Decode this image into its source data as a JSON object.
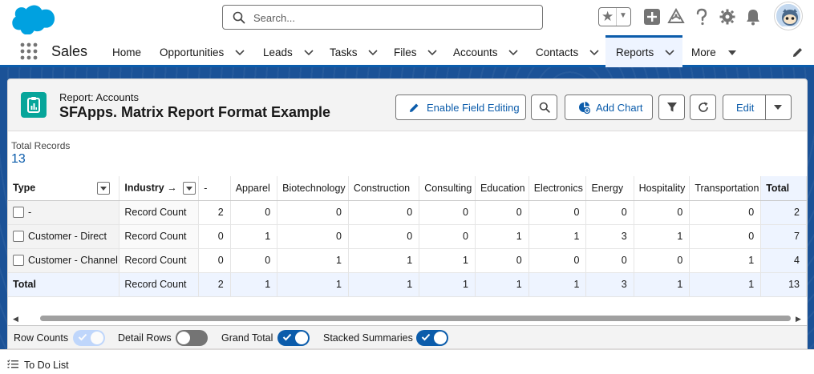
{
  "header": {
    "search_placeholder": "Search...",
    "icons": [
      "salesforce-logo",
      "search-icon",
      "favorites-star-icon",
      "favorites-dropdown-icon",
      "global-actions-icon",
      "trailhead-icon",
      "help-icon",
      "setup-gear-icon",
      "notifications-bell-icon",
      "user-avatar"
    ]
  },
  "nav": {
    "app_name": "Sales",
    "items": [
      {
        "label": "Home",
        "has_menu": false
      },
      {
        "label": "Opportunities",
        "has_menu": true
      },
      {
        "label": "Leads",
        "has_menu": true
      },
      {
        "label": "Tasks",
        "has_menu": true
      },
      {
        "label": "Files",
        "has_menu": true
      },
      {
        "label": "Accounts",
        "has_menu": true
      },
      {
        "label": "Contacts",
        "has_menu": true
      },
      {
        "label": "Reports",
        "has_menu": true,
        "active": true
      },
      {
        "label": "More",
        "has_menu": true
      }
    ]
  },
  "report": {
    "type_label": "Report: Accounts",
    "title": "SFApps. Matrix Report Format Example",
    "buttons": {
      "enable_field_editing": "Enable Field Editing",
      "add_chart": "Add Chart",
      "edit": "Edit"
    },
    "total_records_label": "Total Records",
    "total_records_value": "13"
  },
  "matrix": {
    "row_group_header": "Type",
    "col_group_header": "Industry",
    "col_group_arrow": "→",
    "columns": [
      "-",
      "Apparel",
      "Biotechnology",
      "Construction",
      "Consulting",
      "Education",
      "Electronics",
      "Energy",
      "Hospitality",
      "Transportation",
      "Total"
    ],
    "rows": [
      {
        "label": "-",
        "measure": "Record Count",
        "values": [
          "2",
          "0",
          "0",
          "0",
          "0",
          "0",
          "0",
          "0",
          "0",
          "0",
          "2"
        ]
      },
      {
        "label": "Customer - Direct",
        "measure": "Record Count",
        "values": [
          "0",
          "1",
          "0",
          "0",
          "0",
          "1",
          "1",
          "3",
          "1",
          "0",
          "7"
        ]
      },
      {
        "label": "Customer - Channel",
        "measure": "Record Count",
        "values": [
          "0",
          "0",
          "1",
          "1",
          "1",
          "0",
          "0",
          "0",
          "0",
          "1",
          "4"
        ]
      }
    ],
    "total_row": {
      "label": "Total",
      "measure": "Record Count",
      "values": [
        "2",
        "1",
        "1",
        "1",
        "1",
        "1",
        "1",
        "3",
        "1",
        "1",
        "13"
      ]
    }
  },
  "footer": {
    "toggles": [
      {
        "label": "Row Counts",
        "state": "on",
        "disabled": true
      },
      {
        "label": "Detail Rows",
        "state": "off",
        "disabled": false
      },
      {
        "label": "Grand Total",
        "state": "on",
        "disabled": false
      },
      {
        "label": "Stacked Summaries",
        "state": "on",
        "disabled": false
      }
    ]
  },
  "utility": {
    "todo_label": "To Do List"
  },
  "colors": {
    "brand_blue": "#0b5cab",
    "report_icon": "#06a59a",
    "workspace": "#1b5297"
  }
}
